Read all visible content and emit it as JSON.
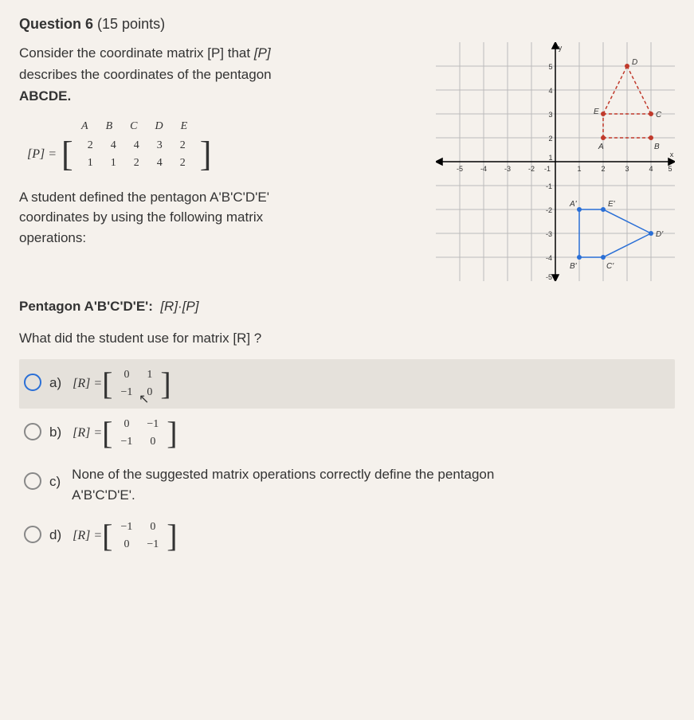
{
  "question": {
    "title_prefix": "Question 6",
    "points": "(15 points)",
    "intro_line1": "Consider the coordinate matrix [P] that",
    "intro_line2": "describes the coordinates of the pentagon",
    "abcde": "ABCDE.",
    "col_headers": [
      "A",
      "B",
      "C",
      "D",
      "E"
    ],
    "matrix_lhs": "[P] =",
    "row1": [
      "2",
      "4",
      "4",
      "3",
      "2"
    ],
    "row2": [
      "1",
      "1",
      "2",
      "4",
      "2"
    ],
    "student_line1": "A student defined the pentagon A'B'C'D'E'",
    "student_line2": "coordinates by using the following matrix",
    "student_line3": "operations:",
    "operation_label": "Pentagon  A'B'C'D'E':",
    "operation_expr": "[R]·[P]",
    "subq": "What did the student use for matrix [R] ?"
  },
  "options": {
    "a": {
      "label": "a)",
      "lhs": "[R] =",
      "r1": [
        "0",
        "1"
      ],
      "r2": [
        "−1",
        "0"
      ],
      "cursor": "⤻"
    },
    "b": {
      "label": "b)",
      "lhs": "[R] =",
      "r1": [
        "0",
        "−1"
      ],
      "r2": [
        "−1",
        "0"
      ]
    },
    "c": {
      "label": "c)",
      "text_line1": "None of the suggested matrix operations correctly define the pentagon",
      "text_line2": "A'B'C'D'E'."
    },
    "d": {
      "label": "d)",
      "lhs": "[R] =",
      "r1": [
        "−1",
        "0"
      ],
      "r2": [
        "0",
        "−1"
      ]
    }
  },
  "chart_data": {
    "type": "scatter",
    "title": "",
    "xlabel": "x",
    "ylabel": "y",
    "xlim": [
      -5,
      5
    ],
    "ylim": [
      -5,
      5
    ],
    "grid": true,
    "points_upper": {
      "A": [
        2,
        1
      ],
      "B": [
        4,
        1
      ],
      "C": [
        4,
        2
      ],
      "D": [
        3,
        4
      ],
      "E": [
        2,
        2
      ]
    },
    "edges_upper": [
      [
        "A",
        "E"
      ],
      [
        "E",
        "C"
      ],
      [
        "E",
        "D"
      ],
      [
        "D",
        "C"
      ],
      [
        "A",
        "B"
      ]
    ],
    "points_lower": {
      "A'": [
        1,
        -2
      ],
      "B'": [
        1,
        -4
      ],
      "C'": [
        2,
        -4
      ],
      "D'": [
        4,
        -3
      ],
      "E'": [
        2,
        -2
      ]
    },
    "edges_lower": [
      [
        "A'",
        "E'"
      ],
      [
        "A'",
        "B'"
      ],
      [
        "B'",
        "C'"
      ],
      [
        "C'",
        "D'"
      ],
      [
        "D'",
        "E'"
      ]
    ]
  }
}
